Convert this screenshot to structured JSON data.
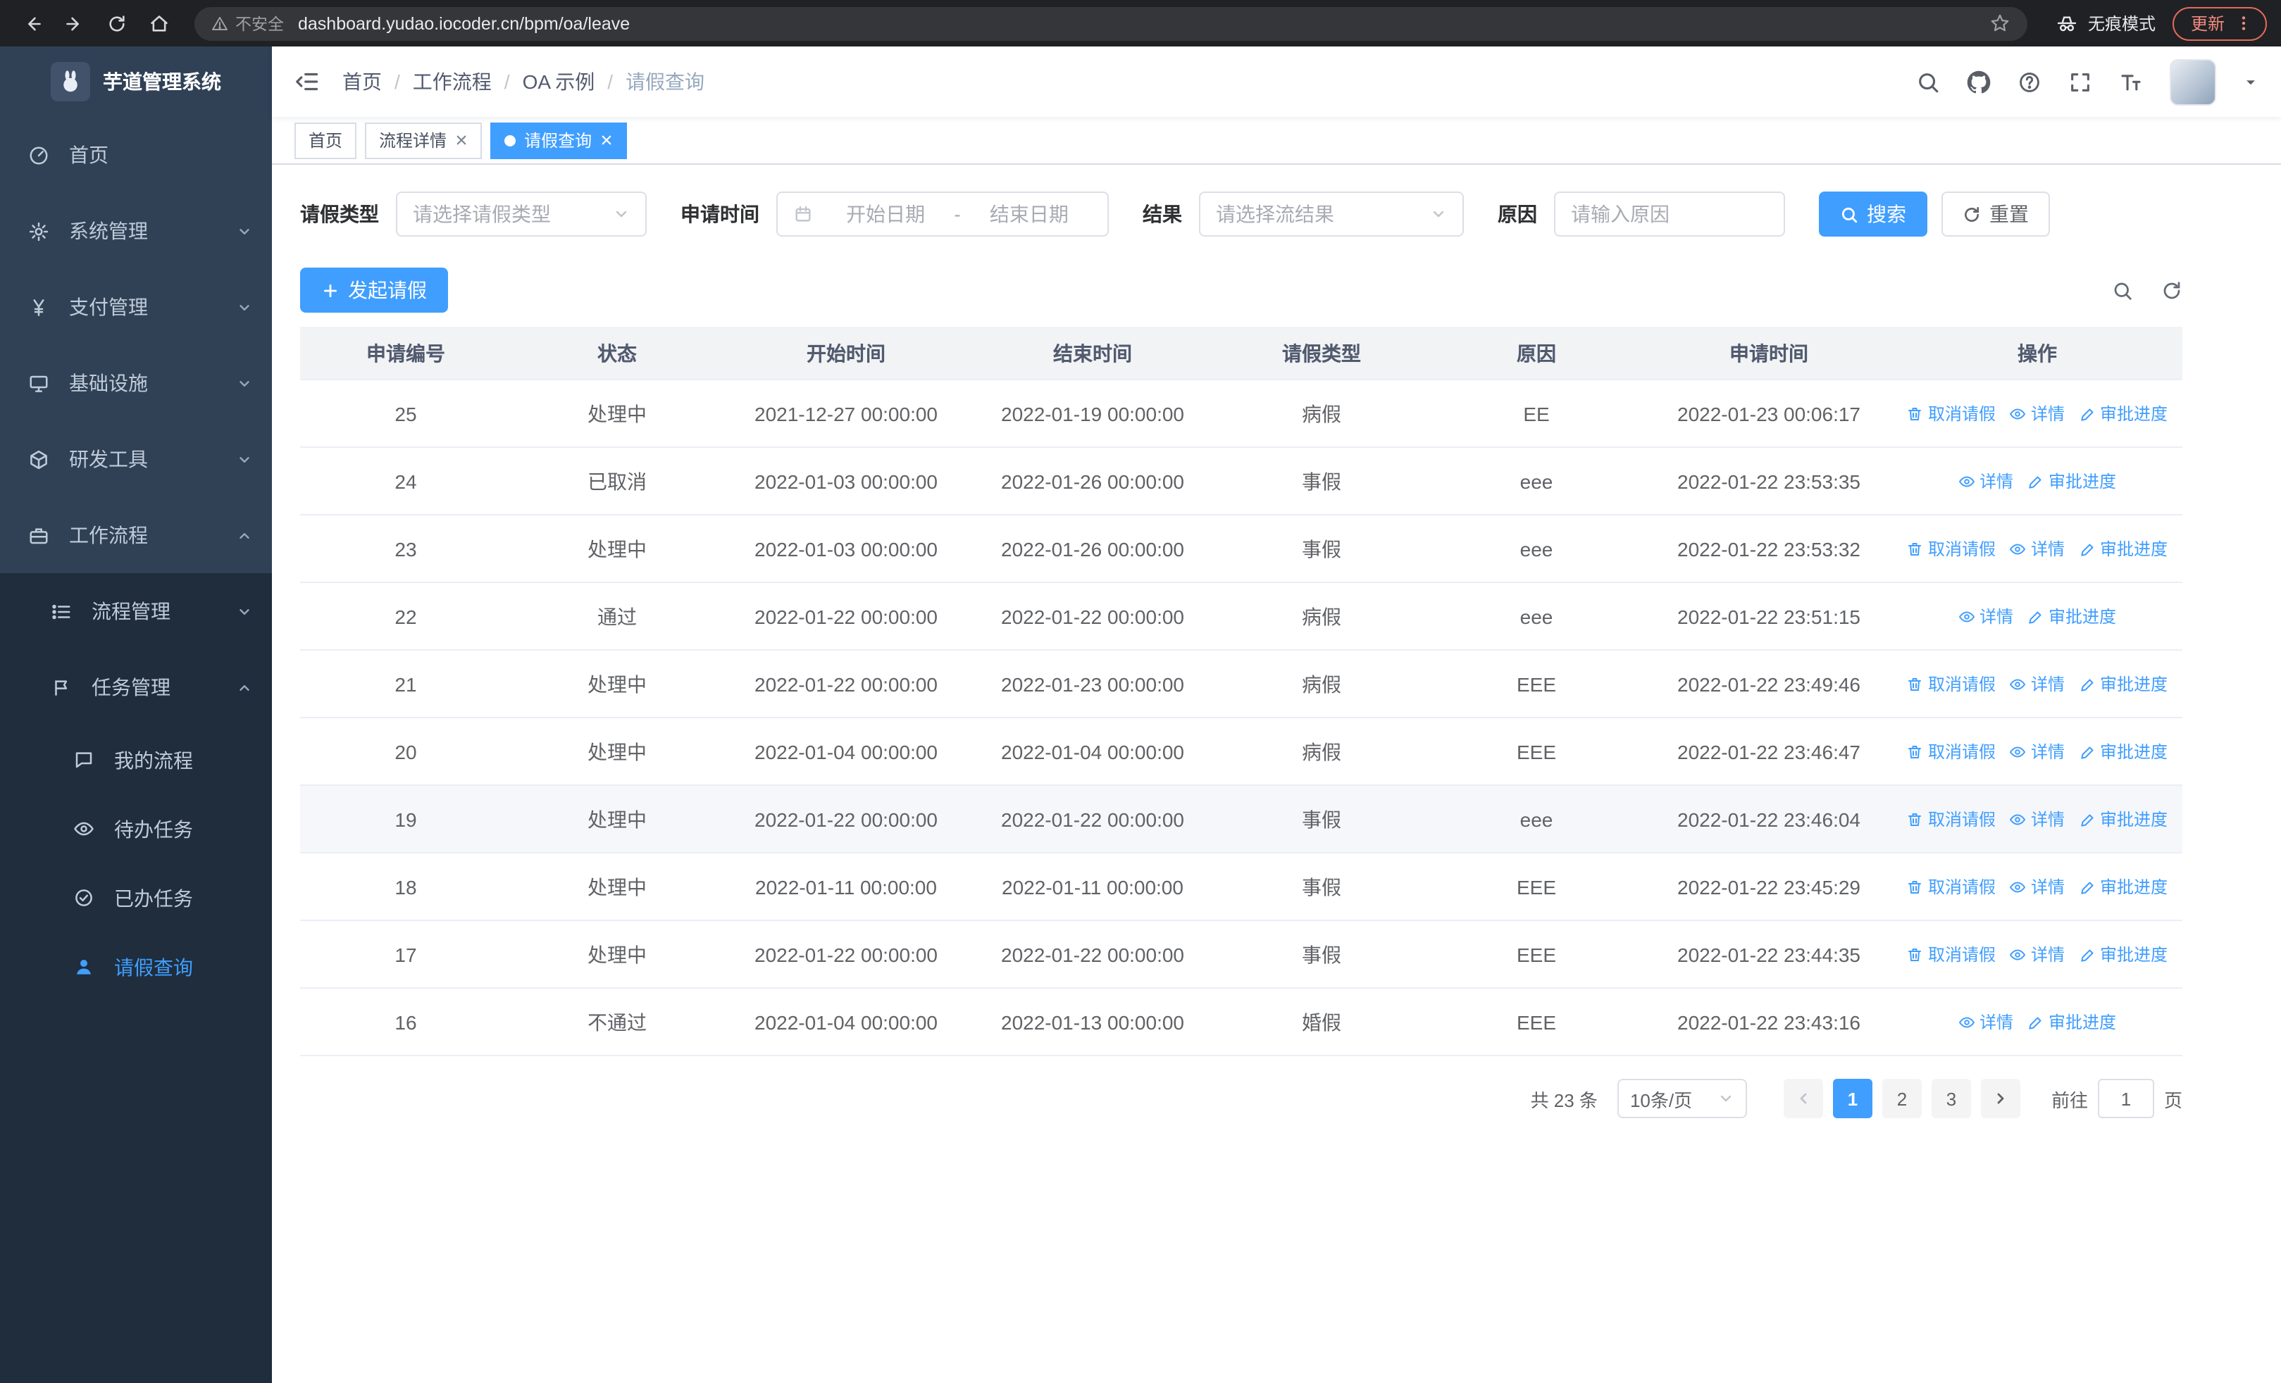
{
  "browser": {
    "security_label": "不安全",
    "url": "dashboard.yudao.iocoder.cn/bpm/oa/leave",
    "incognito_label": "无痕模式",
    "update_label": "更新"
  },
  "sidebar": {
    "logo_text": "芋道管理系统",
    "items": [
      {
        "label": "首页"
      },
      {
        "label": "系统管理"
      },
      {
        "label": "支付管理"
      },
      {
        "label": "基础设施"
      },
      {
        "label": "研发工具"
      },
      {
        "label": "工作流程"
      },
      {
        "label": "流程管理"
      },
      {
        "label": "任务管理"
      },
      {
        "label": "我的流程"
      },
      {
        "label": "待办任务"
      },
      {
        "label": "已办任务"
      },
      {
        "label": "请假查询"
      }
    ]
  },
  "header": {
    "breadcrumb": {
      "separator": "/",
      "items": [
        "首页",
        "工作流程",
        "OA 示例",
        "请假查询"
      ]
    }
  },
  "tabs": {
    "items": [
      {
        "label": "首页"
      },
      {
        "label": "流程详情"
      },
      {
        "label": "请假查询"
      }
    ]
  },
  "filters": {
    "leave_type_label": "请假类型",
    "leave_type_placeholder": "请选择请假类型",
    "apply_time_label": "申请时间",
    "start_date_placeholder": "开始日期",
    "date_separator": "-",
    "end_date_placeholder": "结束日期",
    "result_label": "结果",
    "result_placeholder": "请选择流结果",
    "reason_label": "原因",
    "reason_placeholder": "请输入原因",
    "search_button": "搜索",
    "reset_button": "重置"
  },
  "toolbar": {
    "create_button": "发起请假"
  },
  "table": {
    "columns": [
      "申请编号",
      "状态",
      "开始时间",
      "结束时间",
      "请假类型",
      "原因",
      "申请时间",
      "操作"
    ],
    "actions": {
      "cancel": "取消请假",
      "detail": "详情",
      "progress": "审批进度"
    },
    "rows": [
      {
        "id": "25",
        "status": "处理中",
        "start": "2021-12-27 00:00:00",
        "end": "2022-01-19 00:00:00",
        "type": "病假",
        "reason": "EE",
        "applied": "2022-01-23 00:06:17"
      },
      {
        "id": "24",
        "status": "已取消",
        "start": "2022-01-03 00:00:00",
        "end": "2022-01-26 00:00:00",
        "type": "事假",
        "reason": "eee",
        "applied": "2022-01-22 23:53:35"
      },
      {
        "id": "23",
        "status": "处理中",
        "start": "2022-01-03 00:00:00",
        "end": "2022-01-26 00:00:00",
        "type": "事假",
        "reason": "eee",
        "applied": "2022-01-22 23:53:32"
      },
      {
        "id": "22",
        "status": "通过",
        "start": "2022-01-22 00:00:00",
        "end": "2022-01-22 00:00:00",
        "type": "病假",
        "reason": "eee",
        "applied": "2022-01-22 23:51:15"
      },
      {
        "id": "21",
        "status": "处理中",
        "start": "2022-01-22 00:00:00",
        "end": "2022-01-23 00:00:00",
        "type": "病假",
        "reason": "EEE",
        "applied": "2022-01-22 23:49:46"
      },
      {
        "id": "20",
        "status": "处理中",
        "start": "2022-01-04 00:00:00",
        "end": "2022-01-04 00:00:00",
        "type": "病假",
        "reason": "EEE",
        "applied": "2022-01-22 23:46:47"
      },
      {
        "id": "19",
        "status": "处理中",
        "start": "2022-01-22 00:00:00",
        "end": "2022-01-22 00:00:00",
        "type": "事假",
        "reason": "eee",
        "applied": "2022-01-22 23:46:04"
      },
      {
        "id": "18",
        "status": "处理中",
        "start": "2022-01-11 00:00:00",
        "end": "2022-01-11 00:00:00",
        "type": "事假",
        "reason": "EEE",
        "applied": "2022-01-22 23:45:29"
      },
      {
        "id": "17",
        "status": "处理中",
        "start": "2022-01-22 00:00:00",
        "end": "2022-01-22 00:00:00",
        "type": "事假",
        "reason": "EEE",
        "applied": "2022-01-22 23:44:35"
      },
      {
        "id": "16",
        "status": "不通过",
        "start": "2022-01-04 00:00:00",
        "end": "2022-01-13 00:00:00",
        "type": "婚假",
        "reason": "EEE",
        "applied": "2022-01-22 23:43:16"
      }
    ]
  },
  "pagination": {
    "total_text": "共 23 条",
    "page_size": "10条/页",
    "pages": [
      "1",
      "2",
      "3"
    ],
    "active_page": "1",
    "goto_label": "前往",
    "goto_value": "1",
    "page_unit": "页"
  },
  "colors": {
    "accent": "#409eff",
    "sidebar_bg": "#304156",
    "sidebar_sub_bg": "#1f2d3d",
    "update_badge": "#f08a7e"
  },
  "icons": {
    "cancel_action": "trash-icon",
    "detail_action": "eye-icon",
    "progress_action": "pen-icon",
    "search": "magnifier-icon",
    "reset": "refresh-icon",
    "create": "plus-icon"
  }
}
